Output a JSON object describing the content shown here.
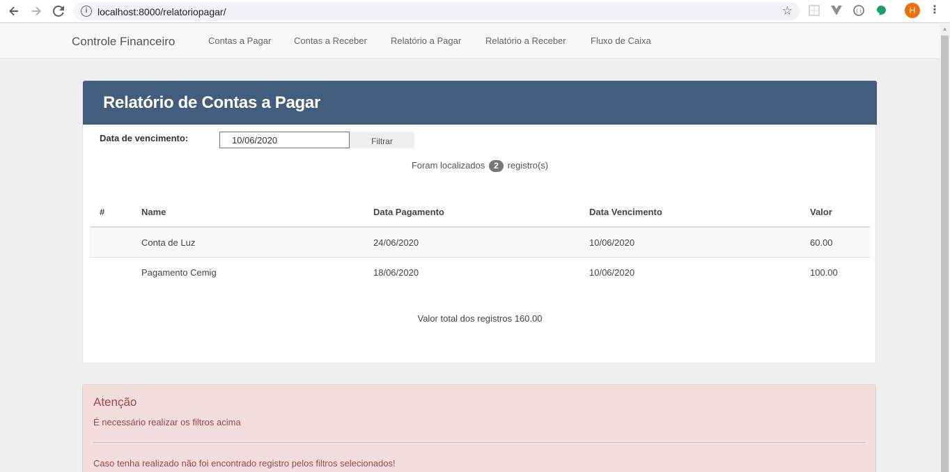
{
  "browser": {
    "url": "localhost:8000/relatoriopagar/",
    "profile_initial": "H"
  },
  "navbar": {
    "brand": "Controle Financeiro",
    "links": [
      "Contas a Pagar",
      "Contas a Receber",
      "Relatório a Pagar",
      "Relatório a Receber",
      "Fluxo de Caixa"
    ]
  },
  "report": {
    "title": "Relatório de Contas a Pagar",
    "filter": {
      "label": "Data de vencimento:",
      "value": "10/06/2020",
      "button": "Filtrar"
    },
    "found": {
      "prefix": "Foram localizados",
      "count": "2",
      "suffix": "registro(s)"
    },
    "table": {
      "columns": [
        "#",
        "Name",
        "Data Pagamento",
        "Data Vencimento",
        "Valor"
      ],
      "rows": [
        {
          "id": "",
          "name": "Conta de Luz",
          "pagamento": "24/06/2020",
          "vencimento": "10/06/2020",
          "valor": "60.00"
        },
        {
          "id": "",
          "name": "Pagamento Cemig",
          "pagamento": "18/06/2020",
          "vencimento": "10/06/2020",
          "valor": "100.00"
        }
      ]
    },
    "total": "Valor total dos registros 160.00"
  },
  "alert": {
    "title": "Atenção",
    "message": "É necessário realizar os filtros acima",
    "message2": "Caso tenha realizado não foi encontrado registro pelos filtros selecionados!"
  },
  "colors": {
    "panel_header": "#435e7d",
    "alert_bg": "#f2dede",
    "alert_text": "#a94442",
    "avatar": "#e8710a"
  }
}
